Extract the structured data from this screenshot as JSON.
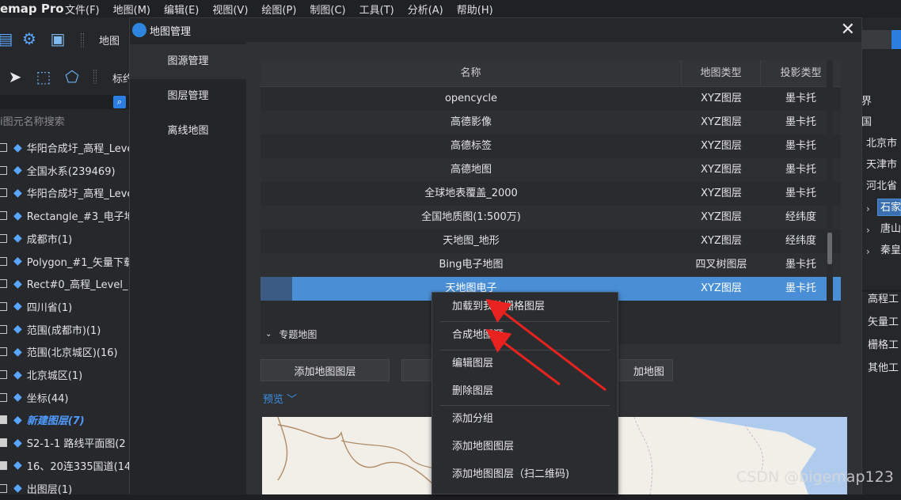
{
  "app": {
    "title": "emap Pro"
  },
  "menu": [
    "文件(F)",
    "地图(M)",
    "编辑(E)",
    "视图(V)",
    "绘图(P)",
    "制图(C)",
    "工具(T)",
    "分析(A)",
    "帮助(H)"
  ],
  "toolbar": {
    "map_label": "地图",
    "mark_label": "标约"
  },
  "left_panel": {
    "search_placeholder": "i图元名称搜索",
    "layers": [
      {
        "name": "华阳合成圩_高程_Leve",
        "checked": false,
        "italic": false
      },
      {
        "name": "全国水系(239469)",
        "checked": false,
        "italic": false
      },
      {
        "name": "华阳合成圩_高程_Leve",
        "checked": false,
        "italic": false
      },
      {
        "name": "Rectangle_#3_电子地",
        "checked": false,
        "italic": false
      },
      {
        "name": "成都市(1)",
        "checked": false,
        "italic": false
      },
      {
        "name": "Polygon_#1_矢量下载",
        "checked": false,
        "italic": false
      },
      {
        "name": "Rect#0_高程_Level_1",
        "checked": false,
        "italic": false
      },
      {
        "name": "四川省(1)",
        "checked": false,
        "italic": false
      },
      {
        "name": "范围(成都市)(1)",
        "checked": false,
        "italic": false
      },
      {
        "name": "范围(北京城区)(16)",
        "checked": false,
        "italic": false
      },
      {
        "name": "北京城区(1)",
        "checked": false,
        "italic": false
      },
      {
        "name": "坐标(44)",
        "checked": false,
        "italic": false
      },
      {
        "name": "新建图层(7)",
        "checked": true,
        "italic": true
      },
      {
        "name": "S2-1-1 路线平面图(2",
        "checked": true,
        "italic": false
      },
      {
        "name": "16、20连335国道(14",
        "checked": true,
        "italic": false
      },
      {
        "name": "出图层(1)",
        "checked": false,
        "italic": false
      }
    ]
  },
  "right_panel": {
    "items": [
      "界",
      "国",
      "北京市",
      "天津市",
      "河北省",
      "石家",
      "唐山",
      "秦皇"
    ],
    "tools": [
      "高程工",
      "矢量工",
      "栅格工",
      "其他工"
    ]
  },
  "dialog": {
    "title": "地图管理",
    "nav": [
      "图源管理",
      "图层管理",
      "离线地图"
    ],
    "table": {
      "headers": [
        "名称",
        "地图类型",
        "投影类型"
      ],
      "rows": [
        {
          "name": "opencycle",
          "type": "XYZ图层",
          "proj": "墨卡托"
        },
        {
          "name": "高德影像",
          "type": "XYZ图层",
          "proj": "墨卡托"
        },
        {
          "name": "高德标签",
          "type": "XYZ图层",
          "proj": "墨卡托"
        },
        {
          "name": "高德地图",
          "type": "XYZ图层",
          "proj": "墨卡托"
        },
        {
          "name": "全球地表覆盖_2000",
          "type": "XYZ图层",
          "proj": "墨卡托"
        },
        {
          "name": "全国地质图(1:500万)",
          "type": "XYZ图层",
          "proj": "经纬度"
        },
        {
          "name": "天地图_地形",
          "type": "XYZ图层",
          "proj": "经纬度"
        },
        {
          "name": "Bing电子地图",
          "type": "四叉树图层",
          "proj": "墨卡托"
        },
        {
          "name": "天地图电子",
          "type": "XYZ图层",
          "proj": "墨卡托",
          "selected": true
        }
      ]
    },
    "group_label": "专题地图",
    "buttons": {
      "add_layer": "添加地图图层",
      "add_map": "加地图"
    },
    "preview_label": "预览"
  },
  "context_menu": [
    "加载到我的栅格图层",
    "合成地图源",
    "编辑图层",
    "删除图层",
    "添加分组",
    "添加地图图层",
    "添加地图图层（扫二维码)"
  ],
  "watermark": "CSDN @bigemap123",
  "colors": {
    "accent": "#2b7de0",
    "selected_row": "#4a8fd6",
    "arrow": "#e8231f"
  }
}
